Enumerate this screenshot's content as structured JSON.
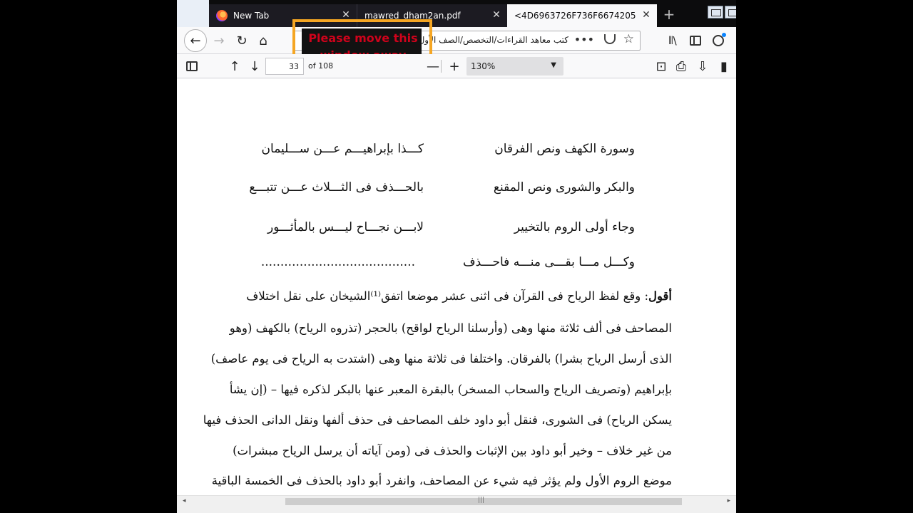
{
  "tabs": [
    {
      "label": "New Tab"
    },
    {
      "label": "mawred_dham2an.pdf"
    },
    {
      "label": "<4D6963726F736F667420576F726"
    }
  ],
  "nav": {
    "url": "كتب معاهد القراءات/التخصص/الصف الأول/ثالثة..."
  },
  "warning": {
    "text": "Please move this window away from"
  },
  "pdf_toolbar": {
    "page_number": "33",
    "page_total": "of 108",
    "zoom": "130%"
  },
  "icons": {
    "back": "back-arrow-icon",
    "forward": "forward-arrow-icon",
    "reload": "reload-icon",
    "home": "home-icon",
    "star": "star-icon"
  },
  "document": {
    "verses": [
      {
        "right": "وسورة الكهف ونص الفرقان",
        "left": "كـــذا بإبراهيـــم عـــن ســـليمان"
      },
      {
        "right": "والبكر والشورى ونص المقنع",
        "left": "بالحـــذف فى الثـــلاث عـــن تتبـــع"
      },
      {
        "right": "وجاء أولى الروم بالتخيير",
        "left": "لابـــن نجـــاح ليـــس بالمأثـــور"
      },
      {
        "right": "وكـــل مـــا بقـــى منـــه فاحـــذف",
        "left": "........................................"
      }
    ],
    "prose_first_bold": "أقول",
    "prose_lines": [
      ": وقع لفظ الرياح فى القرآن فى اثنى عشر موضعا اتفق⁽¹⁾الشيخان على نقل اختلاف",
      "المصاحف فى ألف ثلاثة منها وهى (وأرسلنا الرياح لواقح) بالحجر (تذروه الرياح) بالكهف (وهو",
      "الذى أرسل الرياح بشرا) بالفرقان. واختلفا فى ثلاثة منها وهى (اشتدت به الرياح فى يوم عاصف)",
      "بإبراهيم (وتصريف الرياح والسحاب المسخر) بالبقرة المعبر عنها بالبكر لذكره فيها – (إن يشأ",
      "يسكن الرياح) فى الشورى، فنقل أبو داود خلف المصاحف فى حذف ألفها ونقل الدانى الحذف فيها",
      "من غير خلاف – وخير أبو داود بين الإثبات والحذف فى (ومن آياته أن يرسل الرياح مبشرات)",
      "موضع الروم الأول ولم يؤثر فيه شيء عن المصاحف، وانفرد أبو داود بالحذف فى الخمسة الباقية"
    ]
  }
}
